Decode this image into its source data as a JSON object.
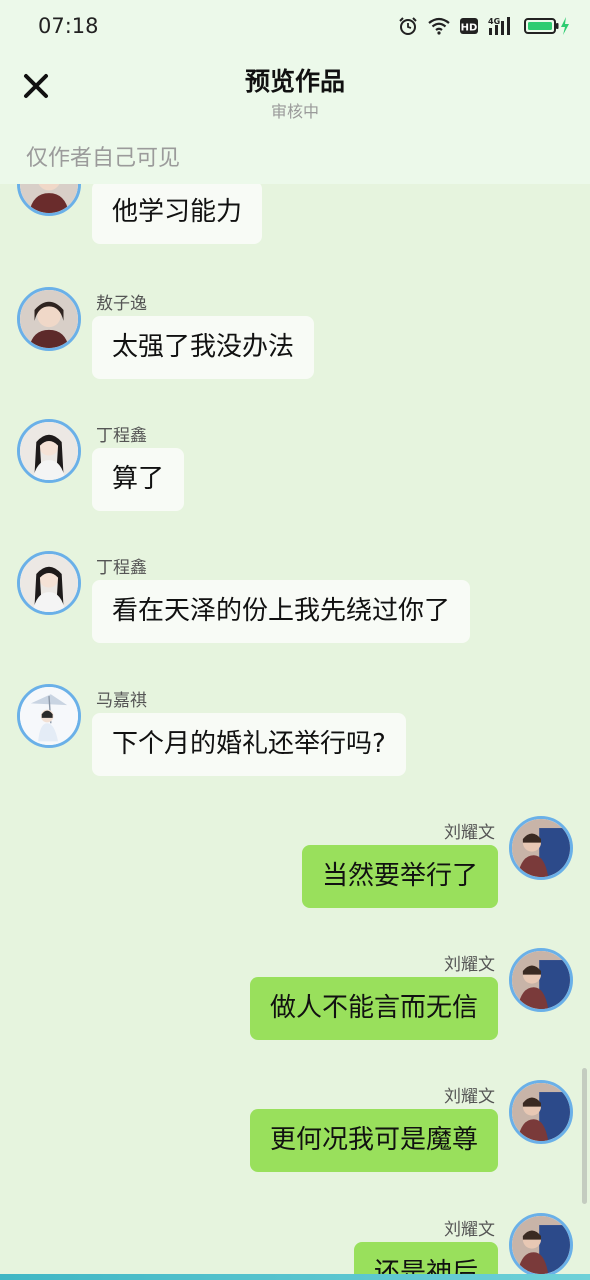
{
  "status_bar": {
    "time": "07:18",
    "hd_label": "HD",
    "network_label": "4G"
  },
  "header": {
    "title": "预览作品",
    "subtitle": "审核中",
    "close_icon": "close-icon"
  },
  "visibility_note": "仅作者自己可见",
  "colors": {
    "topbar_bg": "#ecf9ea",
    "chat_bg": "#e6f4de",
    "left_bubble": "#f8fbf6",
    "right_bubble": "#99e05c",
    "avatar_ring": "#6ab0e8",
    "battery": "#2ecc71"
  },
  "messages": [
    {
      "side": "left",
      "sender": "",
      "text": "他学习能力"
    },
    {
      "side": "left",
      "sender": "敖子逸",
      "text": "太强了我没办法"
    },
    {
      "side": "left",
      "sender": "丁程鑫",
      "text": "算了"
    },
    {
      "side": "left",
      "sender": "丁程鑫",
      "text": "看在天泽的份上我先绕过你了"
    },
    {
      "side": "left",
      "sender": "马嘉祺",
      "text": "下个月的婚礼还举行吗?"
    },
    {
      "side": "right",
      "sender": "刘耀文",
      "text": "当然要举行了"
    },
    {
      "side": "right",
      "sender": "刘耀文",
      "text": "做人不能言而无信"
    },
    {
      "side": "right",
      "sender": "刘耀文",
      "text": "更何况我可是魔尊"
    },
    {
      "side": "right",
      "sender": "刘耀文",
      "text": "还是神后"
    }
  ]
}
